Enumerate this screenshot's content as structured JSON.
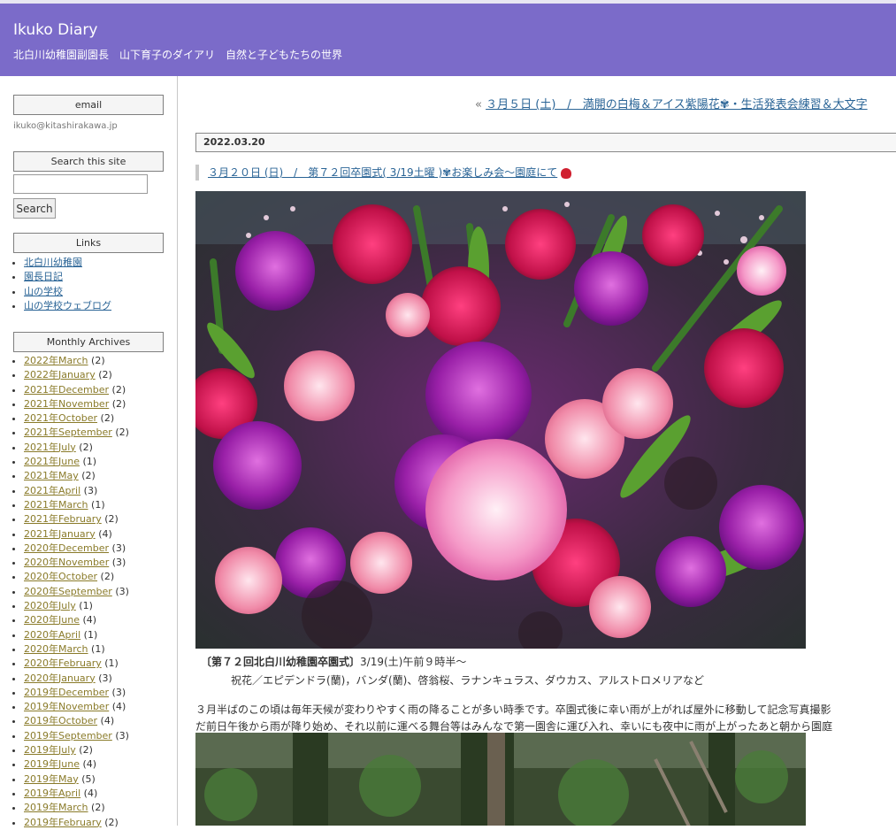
{
  "header": {
    "title": "Ikuko Diary",
    "subtitle": "北白川幼稚園副園長　山下育子のダイアリ　自然と子どもたちの世界"
  },
  "sidebar": {
    "email_heading": "email",
    "email_address": "ikuko@kitashirakawa.jp",
    "search_heading": "Search this site",
    "search_button": "Search",
    "links_heading": "Links",
    "links": [
      "北白川幼稚園",
      "園長日記",
      "山の学校",
      "山の学校ウェブログ"
    ],
    "archives_heading": "Monthly Archives",
    "archives": [
      {
        "year": "2022年",
        "month": "March",
        "count": "(2)"
      },
      {
        "year": "2022年",
        "month": "January",
        "count": "(2)"
      },
      {
        "year": "2021年",
        "month": "December",
        "count": "(2)"
      },
      {
        "year": "2021年",
        "month": "November",
        "count": "(2)"
      },
      {
        "year": "2021年",
        "month": "October",
        "count": "(2)"
      },
      {
        "year": "2021年",
        "month": "September",
        "count": "(2)"
      },
      {
        "year": "2021年",
        "month": "July",
        "count": "(2)"
      },
      {
        "year": "2021年",
        "month": "June",
        "count": "(1)"
      },
      {
        "year": "2021年",
        "month": "May",
        "count": "(2)"
      },
      {
        "year": "2021年",
        "month": "April",
        "count": "(3)"
      },
      {
        "year": "2021年",
        "month": "March",
        "count": "(1)"
      },
      {
        "year": "2021年",
        "month": "February",
        "count": "(2)"
      },
      {
        "year": "2021年",
        "month": "January",
        "count": "(4)"
      },
      {
        "year": "2020年",
        "month": "December",
        "count": "(3)"
      },
      {
        "year": "2020年",
        "month": "November",
        "count": "(3)"
      },
      {
        "year": "2020年",
        "month": "October",
        "count": "(2)"
      },
      {
        "year": "2020年",
        "month": "September",
        "count": "(3)"
      },
      {
        "year": "2020年",
        "month": "July",
        "count": "(1)"
      },
      {
        "year": "2020年",
        "month": "June",
        "count": "(4)"
      },
      {
        "year": "2020年",
        "month": "April",
        "count": "(1)"
      },
      {
        "year": "2020年",
        "month": "March",
        "count": "(1)"
      },
      {
        "year": "2020年",
        "month": "February",
        "count": "(1)"
      },
      {
        "year": "2020年",
        "month": "January",
        "count": "(3)"
      },
      {
        "year": "2019年",
        "month": "December",
        "count": "(3)"
      },
      {
        "year": "2019年",
        "month": "November",
        "count": "(4)"
      },
      {
        "year": "2019年",
        "month": "October",
        "count": "(4)"
      },
      {
        "year": "2019年",
        "month": "September",
        "count": "(3)"
      },
      {
        "year": "2019年",
        "month": "July",
        "count": "(2)"
      },
      {
        "year": "2019年",
        "month": "June",
        "count": "(4)"
      },
      {
        "year": "2019年",
        "month": "May",
        "count": "(5)"
      },
      {
        "year": "2019年",
        "month": "April",
        "count": "(4)"
      },
      {
        "year": "2019年",
        "month": "March",
        "count": "(2)"
      },
      {
        "year": "2019年",
        "month": "February",
        "count": "(2)"
      }
    ]
  },
  "main": {
    "prev_marker": "«",
    "prev_link": "３月５日 (土)　/　満開の白梅＆アイス紫陽花✾・生活発表会練習＆大文字",
    "date": "2022.03.20",
    "entry_title": "３月２０日 (日)　/　第７２回卒園式( 3/19土曜 )✾お楽しみ会～園庭にて",
    "caption_bold": "〔第７２回北白川幼稚園卒園式〕",
    "caption_rest": "3/19(土)午前９時半～",
    "caption_line2": "祝花／エピデンドラ(蘭)，バンダ(蘭)、啓翁桜、ラナンキュラス、ダウカス、アルストロメリアなど",
    "body_line1": "３月半ばのこの頃は毎年天候が変わりやすく雨の降ることが多い時季です。卒園式後に幸い雨が上がれば屋外に移動して記念写真撮影",
    "body_line2": "だ前日午後から雨が降り始め、それ以前に運べる舞台等はみんなで第一園舎に運び入れ、幸いにも夜中に雨が上がったあと朝から園庭"
  }
}
